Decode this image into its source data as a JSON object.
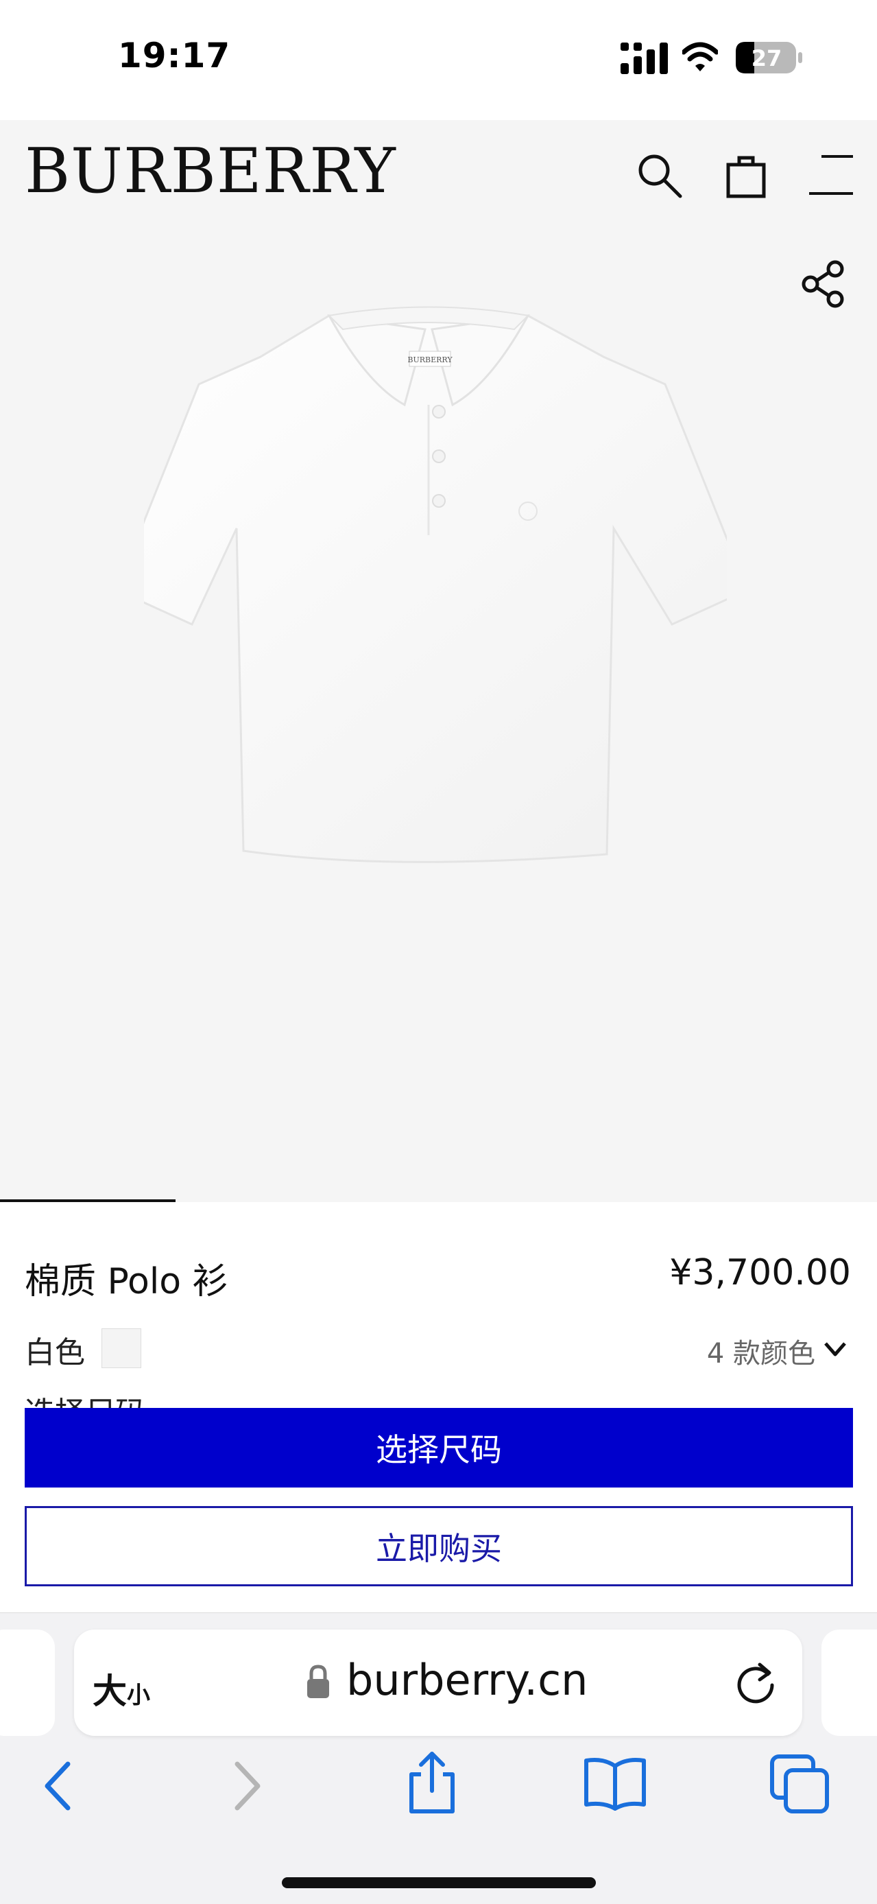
{
  "status_bar": {
    "time": "19:17",
    "battery_level": "27",
    "icons": [
      "signal-icon",
      "wifi-icon",
      "battery-icon"
    ]
  },
  "header": {
    "logo": "BURBERRY",
    "icons": [
      "search-icon",
      "shopping-bag-icon",
      "menu-icon"
    ]
  },
  "product": {
    "name": "棉质 Polo 衫",
    "price": "¥3,700.00",
    "color_label": "白色",
    "color_swatch_hex": "#f4f4f4",
    "color_count_label": "4 款颜色",
    "size_label_partial": "选择尺码",
    "image_label": "BURBERRY",
    "gallery_position": "1/5"
  },
  "actions": {
    "select_size_label": "选择尺码",
    "buy_now_label": "立即购买",
    "primary_color": "#0000cc"
  },
  "browser": {
    "text_size_large": "大",
    "text_size_small": "小",
    "url": "burberry.cn"
  }
}
